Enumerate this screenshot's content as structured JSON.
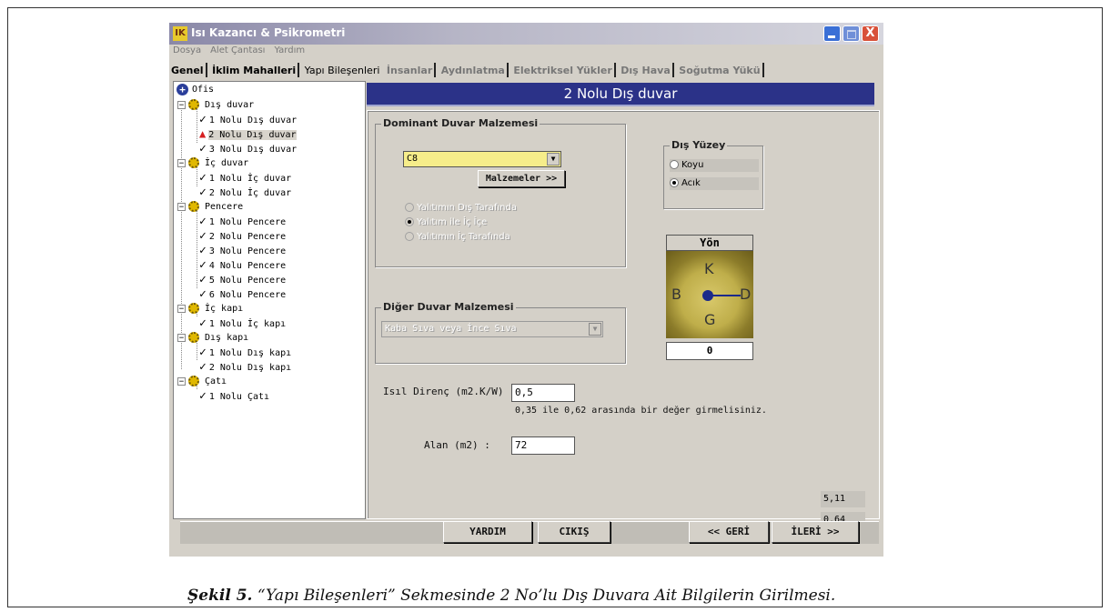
{
  "window": {
    "title": "Isı Kazancı & Psikrometri",
    "close_glyph": "X"
  },
  "menu": [
    "Dosya",
    "Alet Çantası",
    "Yardım"
  ],
  "tabs": [
    {
      "label": "Genel"
    },
    {
      "label": "İklim Mahalleri"
    },
    {
      "label": "Yapı Bileşenleri"
    },
    {
      "label": "İnsanlar"
    },
    {
      "label": "Aydınlatma"
    },
    {
      "label": "Elektriksel Yükler"
    },
    {
      "label": "Dış Hava"
    },
    {
      "label": "Soğutma Yükü"
    }
  ],
  "tree": {
    "root": "Ofis",
    "groups": [
      {
        "label": "Dış duvar",
        "items": [
          "1 Nolu Dış duvar",
          "2 Nolu Dış duvar",
          "3 Nolu Dış duvar"
        ]
      },
      {
        "label": "İç duvar",
        "items": [
          "1 Nolu İç duvar",
          "2 Nolu İç duvar"
        ]
      },
      {
        "label": "Pencere",
        "items": [
          "1 Nolu Pencere",
          "2 Nolu Pencere",
          "3 Nolu Pencere",
          "4 Nolu Pencere",
          "5 Nolu Pencere",
          "6 Nolu Pencere"
        ]
      },
      {
        "label": "İç kapı",
        "items": [
          "1 Nolu İç kapı"
        ]
      },
      {
        "label": "Dış kapı",
        "items": [
          "1 Nolu Dış kapı",
          "2 Nolu Dış kapı"
        ]
      },
      {
        "label": "Çatı",
        "items": [
          "1 Nolu Çatı"
        ]
      }
    ],
    "selected_item": "2 Nolu Dış duvar"
  },
  "panel": {
    "header": "2 Nolu Dış duvar",
    "dominant": {
      "legend": "Dominant Duvar Malzemesi",
      "value": "C8",
      "button": "Malzemeler >>",
      "options": [
        "Yalıtımın Dış Tarafında",
        "Yalıtım ile İç İçe",
        "Yalıtımın İç Tarafında"
      ],
      "selected_option": "Yalıtım ile İç İçe"
    },
    "surface": {
      "legend": "Dış Yüzey",
      "options": [
        "Koyu",
        "Acık"
      ],
      "selected": "Acık"
    },
    "direction": {
      "title": "Yön",
      "labels": {
        "n": "K",
        "s": "G",
        "w": "B",
        "e": "D"
      },
      "value": "0"
    },
    "other": {
      "legend": "Diğer Duvar Malzemesi",
      "value": "Kaba Sıva veya İnce Sıva"
    },
    "thermal": {
      "label": "Isıl Direnç (m2.K/W) :",
      "value": "0,5",
      "hint": "0,35 ile 0,62 arasında bir değer girmelisiniz."
    },
    "area": {
      "label": "Alan  (m2) :",
      "value": "72"
    },
    "readouts": [
      "5,11",
      "0,64"
    ]
  },
  "buttons": {
    "help": "YARDIM",
    "exit": "CIKIŞ",
    "back": "<< GERİ",
    "next": "İLERİ  >>"
  },
  "caption": {
    "prefix": "Şekil 5.",
    "text": " “Yapı Bileşenleri” Sekmesinde 2 No’lu Dış Duvara Ait Bilgilerin Girilmesi."
  }
}
